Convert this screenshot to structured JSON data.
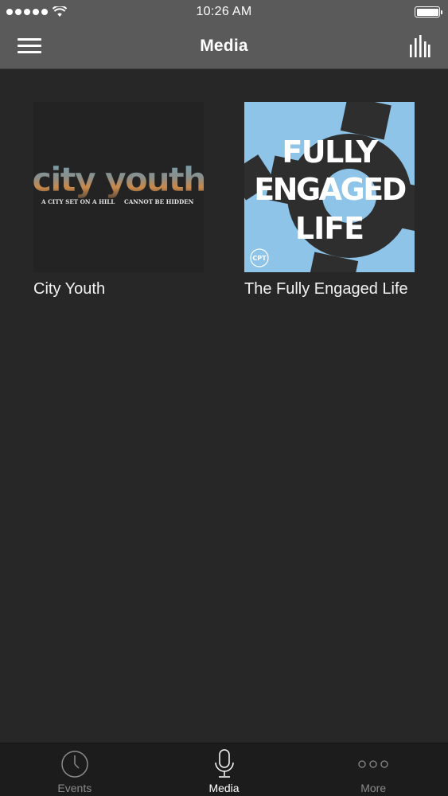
{
  "status_bar": {
    "time": "10:26 AM"
  },
  "nav": {
    "title": "Media",
    "menu_icon": "hamburger-menu-icon",
    "right_icon": "bar-chart-icon"
  },
  "media_items": [
    {
      "title": "City Youth",
      "artwork_text": "city youth",
      "artwork_tagline_left": "A CITY SET ON A HILL",
      "artwork_tagline_right": "CANNOT BE HIDDEN"
    },
    {
      "title": "The Fully Engaged Life",
      "artwork_lines": [
        "FULLY",
        "ENGAGED",
        "LIFE"
      ],
      "artwork_badge": "CPT"
    }
  ],
  "tab_bar": {
    "tabs": [
      {
        "label": "Events",
        "icon": "clock-icon",
        "active": false
      },
      {
        "label": "Media",
        "icon": "microphone-icon",
        "active": true
      },
      {
        "label": "More",
        "icon": "more-dots-icon",
        "active": false
      }
    ]
  },
  "colors": {
    "bar": "#5a5a5a",
    "background": "#272727",
    "tab_bar": "#1c1c1c",
    "accent_light_blue": "#8dc4e8"
  }
}
